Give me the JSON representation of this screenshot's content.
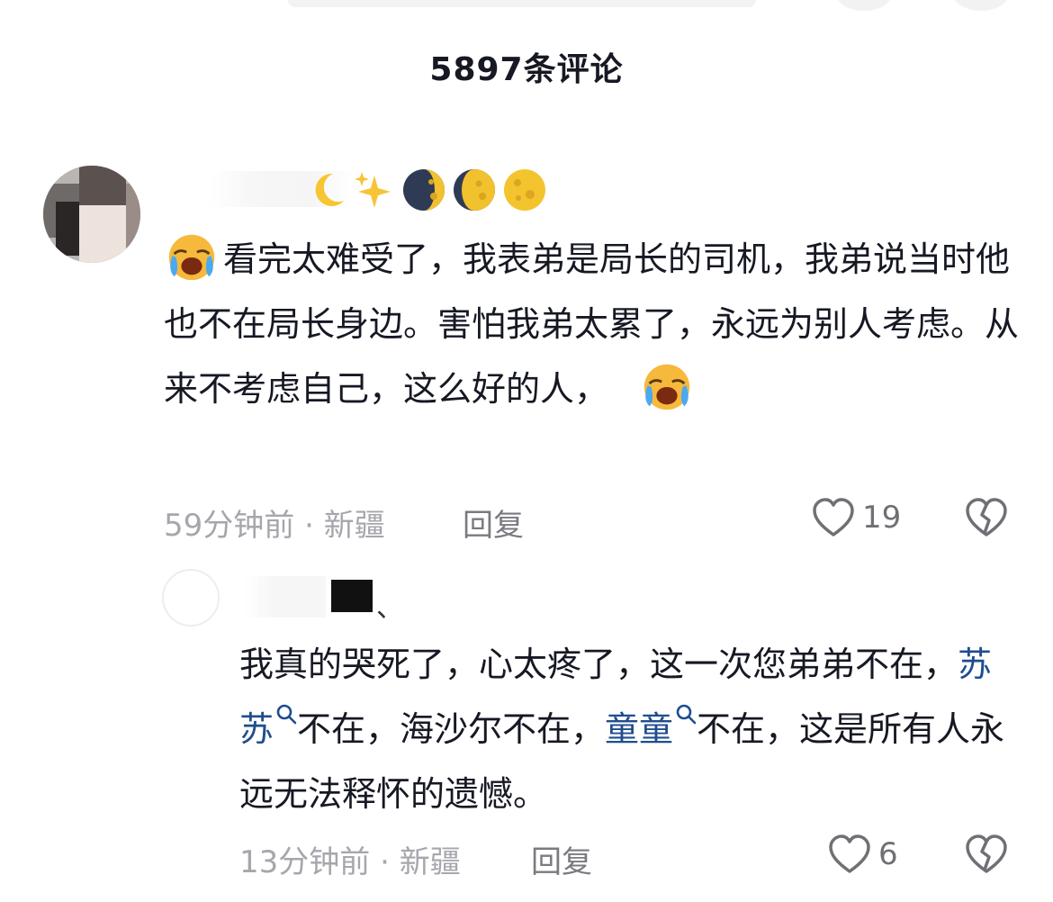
{
  "header": {
    "title": "5897条评论"
  },
  "comments": [
    {
      "name_emojis": [
        "🌙",
        "✨",
        "🌗",
        "🌖",
        "🌕"
      ],
      "text_parts": [
        "看完太难受了，我表弟是局长的司机，我弟说当时他也不在局长身边。害怕我弟太累了，永远为别人考虑。从来不考虑自己，这么好的人，"
      ],
      "time": "59分钟前",
      "separator": "·",
      "location": "新疆",
      "reply_label": "回复",
      "likes": "19",
      "leading_emoji": "crying-face",
      "trailing_emoji": "crying-face"
    }
  ],
  "reply": {
    "name_suffix": "、",
    "text": {
      "p1": "我真的哭死了，心太疼了，这一次您弟弟不在，",
      "topic1": "苏苏",
      "p2": "不在，海沙尔不在，",
      "topic2": "童童",
      "p3": "不在，这是所有人永远无法释怀的遗憾。"
    },
    "time": "13分钟前",
    "separator": "·",
    "location": "新疆",
    "reply_label": "回复",
    "likes": "6"
  },
  "colors": {
    "text": "#161823",
    "meta": "#a6a6ad",
    "topic": "#1f4d8e"
  },
  "icons": [
    "heart-outline-icon",
    "broken-heart-icon",
    "search-icon",
    "crying-face-emoji"
  ]
}
